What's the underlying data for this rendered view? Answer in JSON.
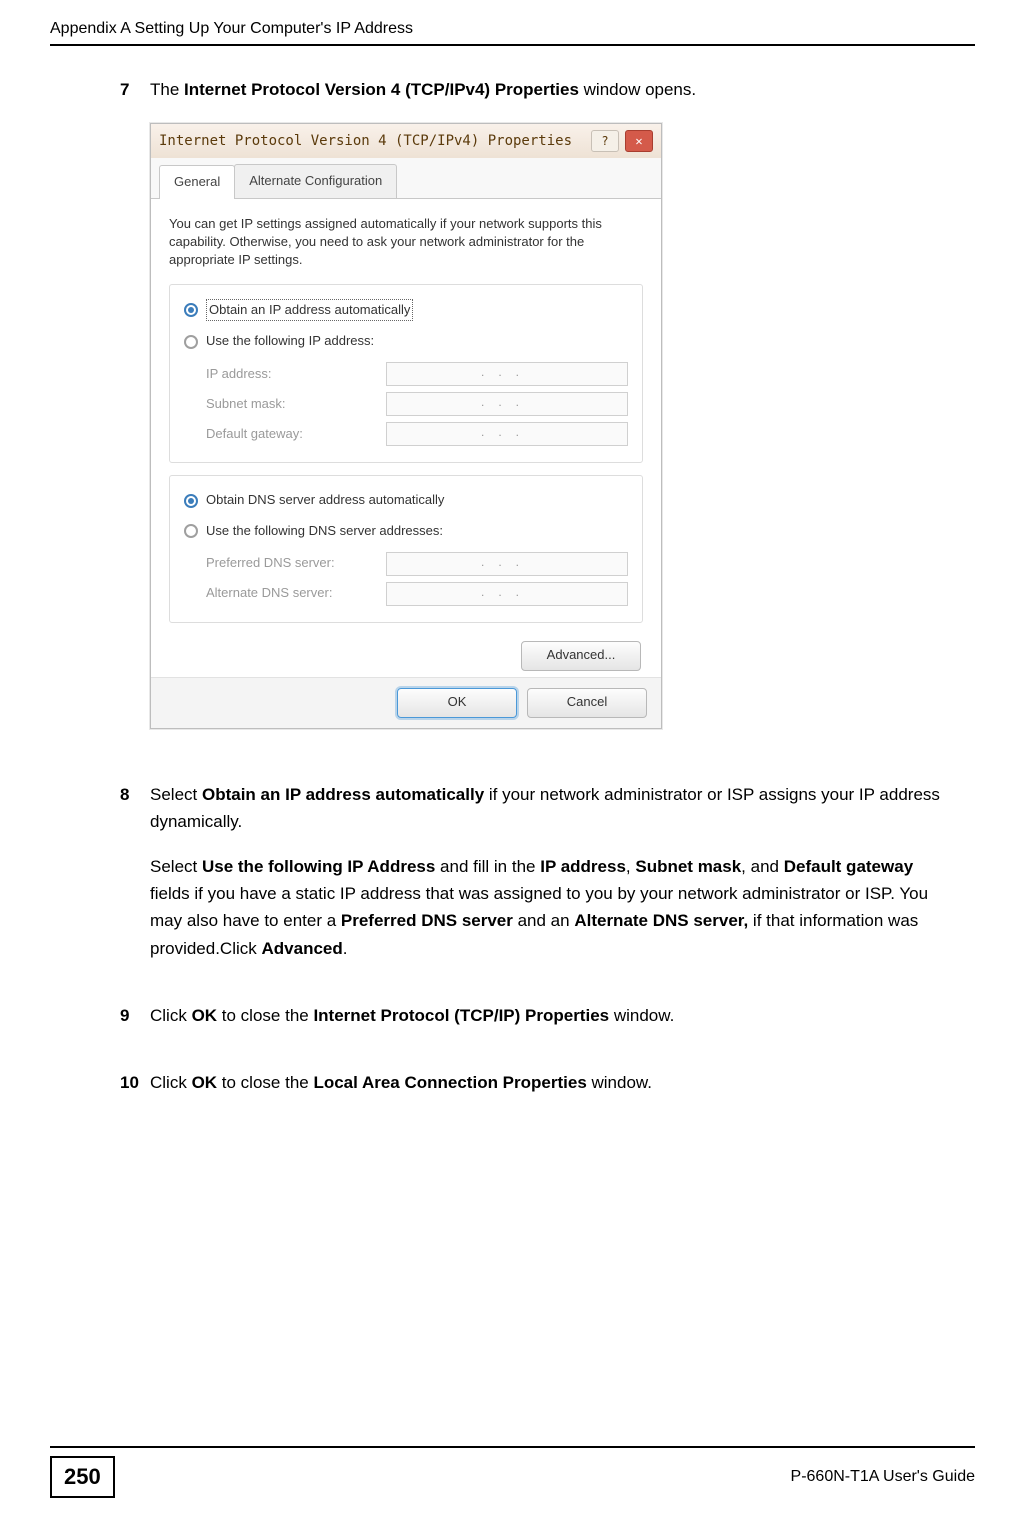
{
  "header": "Appendix A Setting Up Your Computer's IP Address",
  "steps": {
    "s7": {
      "num": "7",
      "text_pre": "The ",
      "bold1": "Internet Protocol Version 4 (TCP/IPv4) Properties",
      "text_post": " window opens."
    },
    "s8": {
      "num": "8",
      "p1_pre": "Select ",
      "p1_b1": "Obtain an IP address automatically",
      "p1_post": " if your network administrator or ISP assigns your IP address dynamically.",
      "p2_pre": "Select ",
      "p2_b1": "Use the following IP Address",
      "p2_mid1": " and fill in the ",
      "p2_b2": "IP address",
      "p2_mid2": ", ",
      "p2_b3": "Subnet mask",
      "p2_mid3": ", and ",
      "p2_b4": "Default gateway",
      "p2_mid4": " fields if you have a static IP address that was assigned to you by your network administrator or ISP. You may also have to enter a ",
      "p2_b5": "Preferred DNS server",
      "p2_mid5": " and an ",
      "p2_b6": "Alternate DNS server,",
      "p2_mid6": " if that information was provided.Click ",
      "p2_b7": "Advanced",
      "p2_post": "."
    },
    "s9": {
      "num": "9",
      "pre": "Click ",
      "b1": "OK",
      "mid": " to close the ",
      "b2": "Internet Protocol (TCP/IP) Properties",
      "post": " window."
    },
    "s10": {
      "num": "10",
      "pre": "Click ",
      "b1": "OK",
      "mid": " to close the ",
      "b2": "Local Area Connection Properties",
      "post": " window."
    }
  },
  "dialog": {
    "title": "Internet Protocol Version 4 (TCP/IPv4) Properties",
    "help_icon": "?",
    "close_icon": "✕",
    "tabs": {
      "general": "General",
      "alt": "Alternate Configuration"
    },
    "desc": "You can get IP settings assigned automatically if your network supports this capability. Otherwise, you need to ask your network administrator for the appropriate IP settings.",
    "radio_auto_ip": "Obtain an IP address automatically",
    "radio_use_ip": "Use the following IP address:",
    "lbl_ip": "IP address:",
    "lbl_subnet": "Subnet mask:",
    "lbl_gateway": "Default gateway:",
    "radio_auto_dns": "Obtain DNS server address automatically",
    "radio_use_dns": "Use the following DNS server addresses:",
    "lbl_pref_dns": "Preferred DNS server:",
    "lbl_alt_dns": "Alternate DNS server:",
    "dots": "...",
    "advanced": "Advanced...",
    "ok": "OK",
    "cancel": "Cancel"
  },
  "footer": {
    "page_number": "250",
    "guide": "P-660N-T1A User's Guide"
  }
}
